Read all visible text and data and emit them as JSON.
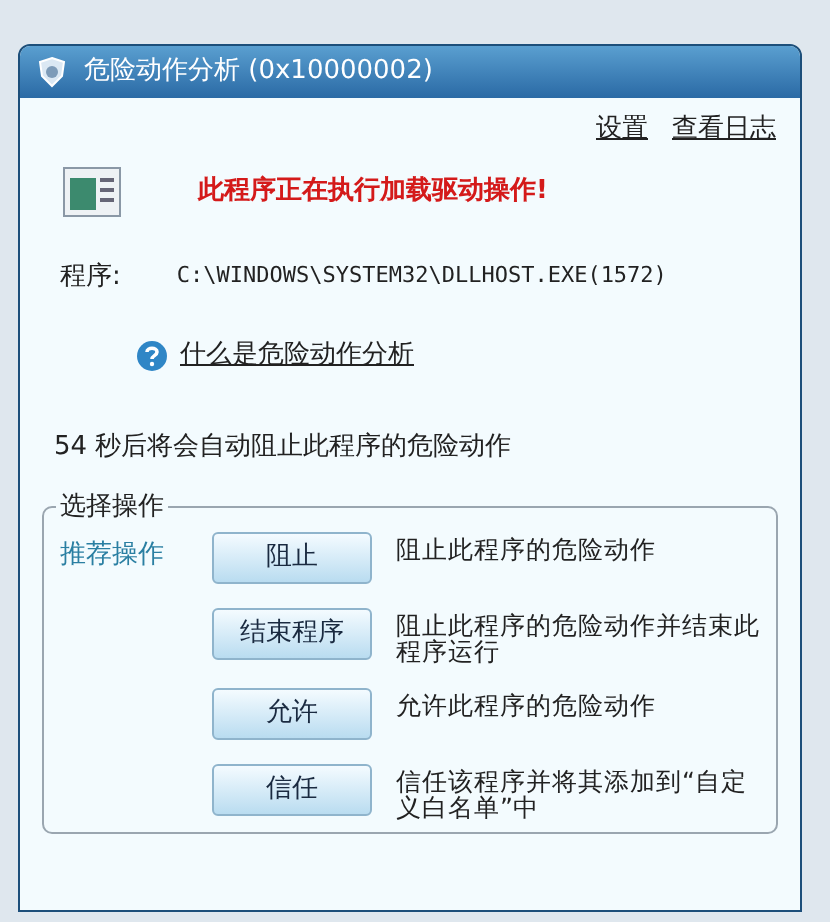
{
  "window": {
    "title": "危险动作分析 (0x10000002)"
  },
  "links": [
    "设置",
    "查看日志"
  ],
  "warning": "此程序正在执行加载驱动操作!",
  "program": {
    "label": "程序:",
    "path": "C:\\WINDOWS\\SYSTEM32\\DLLHOST.EXE(1572)"
  },
  "help_link": "什么是危险动作分析",
  "countdown": "54 秒后将会自动阻止此程序的危险动作",
  "actions": {
    "title": "选择操作",
    "options": [
      {
        "tag": "推荐操作",
        "button": "阻止",
        "description": "阻止此程序的危险动作"
      },
      {
        "button": "结束程序",
        "description": "阻止此程序的危险动作并结束此程序运行"
      },
      {
        "button": "允许",
        "description": "允许此程序的危险动作"
      },
      {
        "button": "信任",
        "description": "信任该程序并将其添加到“自定义白名单”中"
      }
    ]
  }
}
